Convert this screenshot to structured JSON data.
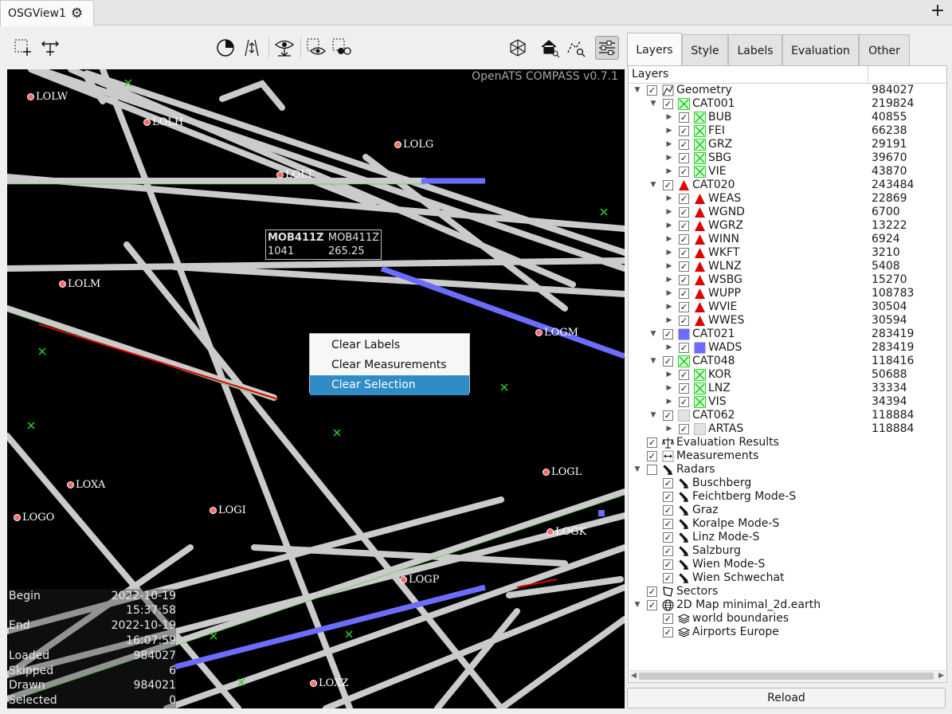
{
  "window": {
    "tab_title": "OSGView1",
    "settings_icon": "gear-icon",
    "add_tab": "+"
  },
  "map": {
    "watermark": "OpenATS COMPASS v0.7.1",
    "airports": [
      "LOLW",
      "LOLH",
      "LOLG",
      "LOLT",
      "LOLM",
      "LOGM",
      "LOXA",
      "LOGL",
      "LOGI",
      "LOGO",
      "LOGK",
      "LOGP",
      "LOXZ"
    ],
    "track_label": {
      "callsign": "MOB411Z",
      "callsign2": "MOB411Z",
      "mode_c": "1041",
      "speed": "265.25"
    },
    "stats": [
      {
        "key": "Begin",
        "value": "2022-10-19 15:37:58"
      },
      {
        "key": "End",
        "value": "2022-10-19 16:07:59"
      },
      {
        "key": "Loaded",
        "value": "984027"
      },
      {
        "key": "Skipped",
        "value": "6"
      },
      {
        "key": "Drawn",
        "value": "984021"
      },
      {
        "key": "Selected",
        "value": "0"
      }
    ]
  },
  "context_menu": {
    "items": [
      "Clear Labels",
      "Clear Measurements",
      "Clear Selection"
    ],
    "selected_index": 2
  },
  "right_tabs": [
    "Layers",
    "Style",
    "Labels",
    "Evaluation",
    "Other"
  ],
  "layers": {
    "header": "Layers",
    "reload_label": "Reload",
    "tree": [
      {
        "level": 0,
        "expand": "down",
        "checked": true,
        "icon": "geometry",
        "label": "Geometry",
        "count": "984027"
      },
      {
        "level": 1,
        "expand": "down",
        "checked": true,
        "icon": "green-x",
        "label": "CAT001",
        "count": "219824"
      },
      {
        "level": 2,
        "expand": "right",
        "checked": true,
        "icon": "green-x",
        "label": "BUB",
        "count": "40855"
      },
      {
        "level": 2,
        "expand": "right",
        "checked": true,
        "icon": "green-x",
        "label": "FEI",
        "count": "66238"
      },
      {
        "level": 2,
        "expand": "right",
        "checked": true,
        "icon": "green-x",
        "label": "GRZ",
        "count": "29191"
      },
      {
        "level": 2,
        "expand": "right",
        "checked": true,
        "icon": "green-x",
        "label": "SBG",
        "count": "39670"
      },
      {
        "level": 2,
        "expand": "right",
        "checked": true,
        "icon": "green-x",
        "label": "VIE",
        "count": "43870"
      },
      {
        "level": 1,
        "expand": "down",
        "checked": true,
        "icon": "red-triangle",
        "label": "CAT020",
        "count": "243484"
      },
      {
        "level": 2,
        "expand": "right",
        "checked": true,
        "icon": "red-triangle",
        "label": "WEAS",
        "count": "22869"
      },
      {
        "level": 2,
        "expand": "right",
        "checked": true,
        "icon": "red-triangle",
        "label": "WGND",
        "count": "6700"
      },
      {
        "level": 2,
        "expand": "right",
        "checked": true,
        "icon": "red-triangle",
        "label": "WGRZ",
        "count": "13222"
      },
      {
        "level": 2,
        "expand": "right",
        "checked": true,
        "icon": "red-triangle",
        "label": "WINN",
        "count": "6924"
      },
      {
        "level": 2,
        "expand": "right",
        "checked": true,
        "icon": "red-triangle",
        "label": "WKFT",
        "count": "3210"
      },
      {
        "level": 2,
        "expand": "right",
        "checked": true,
        "icon": "red-triangle",
        "label": "WLNZ",
        "count": "5408"
      },
      {
        "level": 2,
        "expand": "right",
        "checked": true,
        "icon": "red-triangle",
        "label": "WSBG",
        "count": "15270"
      },
      {
        "level": 2,
        "expand": "right",
        "checked": true,
        "icon": "red-triangle",
        "label": "WUPP",
        "count": "108783"
      },
      {
        "level": 2,
        "expand": "right",
        "checked": true,
        "icon": "red-triangle",
        "label": "WVIE",
        "count": "30504"
      },
      {
        "level": 2,
        "expand": "right",
        "checked": true,
        "icon": "red-triangle",
        "label": "WWES",
        "count": "30594"
      },
      {
        "level": 1,
        "expand": "down",
        "checked": true,
        "icon": "blue-square",
        "label": "CAT021",
        "count": "283419"
      },
      {
        "level": 2,
        "expand": "right",
        "checked": true,
        "icon": "blue-square",
        "label": "WADS",
        "count": "283419"
      },
      {
        "level": 1,
        "expand": "down",
        "checked": true,
        "icon": "green-x",
        "label": "CAT048",
        "count": "118416"
      },
      {
        "level": 2,
        "expand": "right",
        "checked": true,
        "icon": "green-x",
        "label": "KOR",
        "count": "50688"
      },
      {
        "level": 2,
        "expand": "right",
        "checked": true,
        "icon": "green-x",
        "label": "LNZ",
        "count": "33334"
      },
      {
        "level": 2,
        "expand": "right",
        "checked": true,
        "icon": "green-x",
        "label": "VIS",
        "count": "34394"
      },
      {
        "level": 1,
        "expand": "down",
        "checked": true,
        "icon": "gray-square",
        "label": "CAT062",
        "count": "118884"
      },
      {
        "level": 2,
        "expand": "right",
        "checked": true,
        "icon": "gray-square",
        "label": "ARTAS",
        "count": "118884"
      },
      {
        "level": 0,
        "expand": "none",
        "checked": true,
        "icon": "scale",
        "label": "Evaluation Results",
        "count": ""
      },
      {
        "level": 0,
        "expand": "none",
        "checked": true,
        "icon": "measure",
        "label": "Measurements",
        "count": ""
      },
      {
        "level": 0,
        "expand": "down",
        "checked": false,
        "icon": "radar",
        "label": "Radars",
        "count": ""
      },
      {
        "level": 1,
        "expand": "none",
        "checked": true,
        "icon": "radar",
        "label": "Buschberg",
        "count": ""
      },
      {
        "level": 1,
        "expand": "none",
        "checked": true,
        "icon": "radar",
        "label": "Feichtberg Mode-S",
        "count": ""
      },
      {
        "level": 1,
        "expand": "none",
        "checked": true,
        "icon": "radar",
        "label": "Graz",
        "count": ""
      },
      {
        "level": 1,
        "expand": "none",
        "checked": true,
        "icon": "radar",
        "label": "Koralpe Mode-S",
        "count": ""
      },
      {
        "level": 1,
        "expand": "none",
        "checked": true,
        "icon": "radar",
        "label": "Linz Mode-S",
        "count": ""
      },
      {
        "level": 1,
        "expand": "none",
        "checked": true,
        "icon": "radar",
        "label": "Salzburg",
        "count": ""
      },
      {
        "level": 1,
        "expand": "none",
        "checked": true,
        "icon": "radar",
        "label": "Wien Mode-S",
        "count": ""
      },
      {
        "level": 1,
        "expand": "none",
        "checked": true,
        "icon": "radar",
        "label": "Wien Schwechat",
        "count": ""
      },
      {
        "level": 0,
        "expand": "none",
        "checked": true,
        "icon": "sector",
        "label": "Sectors",
        "count": ""
      },
      {
        "level": 0,
        "expand": "down",
        "checked": true,
        "icon": "globe",
        "label": "2D Map minimal_2d.earth",
        "count": ""
      },
      {
        "level": 1,
        "expand": "none",
        "checked": true,
        "icon": "layers",
        "label": "world boundaries",
        "count": ""
      },
      {
        "level": 1,
        "expand": "none",
        "checked": true,
        "icon": "layers",
        "label": "Airports Europe",
        "count": ""
      }
    ]
  },
  "colors": {
    "selection": "#308cc6",
    "track": "#d8d8d8",
    "marker_green": "#2bd12b",
    "cat020_red": "#e00000",
    "cat021_blue": "#6c6cff"
  }
}
